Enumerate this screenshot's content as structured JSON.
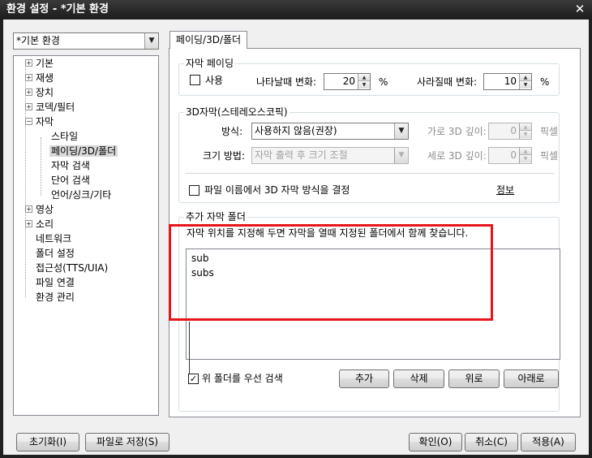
{
  "window": {
    "title": "환경 설정 - *기본 환경",
    "close_icon": "✕"
  },
  "profile_combo": {
    "value": "*기본 환경"
  },
  "tree": {
    "items": [
      {
        "label": "기본",
        "expander": "+"
      },
      {
        "label": "재생",
        "expander": "+"
      },
      {
        "label": "장치",
        "expander": "+"
      },
      {
        "label": "코덱/필터",
        "expander": "+"
      },
      {
        "label": "자막",
        "expander": "−"
      },
      {
        "label": "스타일"
      },
      {
        "label": "페이딩/3D/폴더",
        "selected": true
      },
      {
        "label": "자막 검색"
      },
      {
        "label": "단어 검색"
      },
      {
        "label": "언어/싱크/기타"
      },
      {
        "label": "영상",
        "expander": "+"
      },
      {
        "label": "소리",
        "expander": "+"
      },
      {
        "label": "네트워크"
      },
      {
        "label": "폴더 설정"
      },
      {
        "label": "접근성(TTS/UIA)"
      },
      {
        "label": "파일 연결"
      },
      {
        "label": "환경 관리"
      }
    ]
  },
  "tab": {
    "label": "페이딩/3D/폴더"
  },
  "fading": {
    "group_title": "자막 페이딩",
    "use_label": "사용",
    "use_checked": false,
    "appear_label": "나타날때 변화:",
    "appear_value": "20",
    "appear_unit": "%",
    "disappear_label": "사라질때 변화:",
    "disappear_value": "10",
    "disappear_unit": "%"
  },
  "stereo": {
    "group_title": "3D자막(스테레오스코픽)",
    "method_label": "방식:",
    "method_value": "사용하지 않음(권장)",
    "size_label": "크기 방법:",
    "size_value": "자막 출력 후 크기 조절",
    "h_depth_label": "가로 3D 깊이:",
    "h_depth_value": "0",
    "h_depth_unit": "픽셀",
    "v_depth_label": "세로 3D 깊이:",
    "v_depth_value": "0",
    "v_depth_unit": "픽셀",
    "filename_label": "파일 이름에서 3D 자막 방식을 결정",
    "filename_checked": false,
    "info_link": "정보"
  },
  "extra_folders": {
    "group_title": "추가 자막 폴더",
    "description": "자막 위치를 지정해 두면 자막을 열때 지정된 폴더에서 함께 찾습니다.",
    "items": [
      "sub",
      "subs"
    ],
    "priority_label": "위 폴더를 우선 검색",
    "priority_checked": true,
    "add_label": "추가",
    "delete_label": "삭제",
    "up_label": "위로",
    "down_label": "아래로"
  },
  "footer": {
    "reset_label": "초기화(I)",
    "save_file_label": "파일로 저장(S)",
    "ok_label": "확인(O)",
    "cancel_label": "취소(C)",
    "apply_label": "적용(A)"
  },
  "colors": {
    "highlight": "#e8141b",
    "titlebar": "#1c1c1c",
    "client": "#f0f0f0"
  }
}
